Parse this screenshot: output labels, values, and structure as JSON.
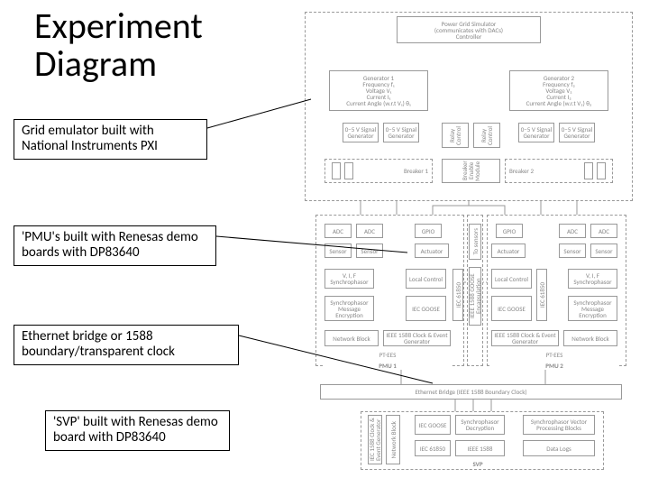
{
  "title_line1": "Experiment",
  "title_line2": "Diagram",
  "callouts": {
    "c1": "Grid emulator built with National Instruments PXI",
    "c2": "'PMU's built with Renesas demo boards with DP83640",
    "c3": "Ethernet bridge or 1588 boundary/transparent clock",
    "c4": "'SVP' built with Renesas demo board with DP83640"
  },
  "diagram": {
    "top_controller_line1": "Power Grid Simulator",
    "top_controller_line2": "(communicates with DACs)",
    "top_controller_sub": "Controller",
    "gen1_title": "Generator 1",
    "gen1_l1": "Frequency f₁",
    "gen1_l2": "Voltage V₁",
    "gen1_l3": "Current I₁",
    "gen1_l4": "Current Angle (w.r.t V₁) θ₁",
    "gen2_title": "Generator 2",
    "gen2_l1": "Frequency f₂",
    "gen2_l2": "Voltage V₂",
    "gen2_l3": "Current I₂",
    "gen2_l4": "Current Angle (w.r.t V₂) θ₂",
    "sig_gen": "0–5 V Signal Generator",
    "breaker1": "Breaker 1",
    "breaker2": "Breaker 2",
    "relay": "Relay Control",
    "breaker_module": "Breaker Enable Module",
    "adc": "ADC",
    "gpio": "GPIO",
    "sensor": "Sensor",
    "actuator": "Actuator",
    "sync": "V, I, F Synchrophasor",
    "local_control": "Local Control",
    "sub_a": "Synchrophasor Message Encryption",
    "sub_b": "IEC GOOSE",
    "iec_side": "IEC 61850",
    "to_sensors": "To sensors",
    "ieee_goose": "IEEE 1588 GOOSE Encapsulation",
    "sync_other": "V, I, F Synchrophasor",
    "net_block": "Network Block",
    "clock_gen": "IEEE 1588 Clock & Event Generator",
    "pt_ees": "PT-EES",
    "pmu1": "PMU 1",
    "pmu2": "PMU 2",
    "eth_bridge": "Ethernet Bridge (IEEE 1588 Boundary Clock)",
    "svp_label": "SVP",
    "svp_left1": "IEC 1588 Clock & Event Generator",
    "svp_left2": "Network Block",
    "svp_mid1_a": "IEC GOOSE",
    "svp_mid1_b": "Synchrophasor Decryption",
    "svp_mid2_a": "IEC 61850",
    "svp_mid2_b": "IEEE 1588",
    "svp_right1": "Synchrophasor Vector Processing Blocks",
    "svp_right2": "Data Logs"
  }
}
